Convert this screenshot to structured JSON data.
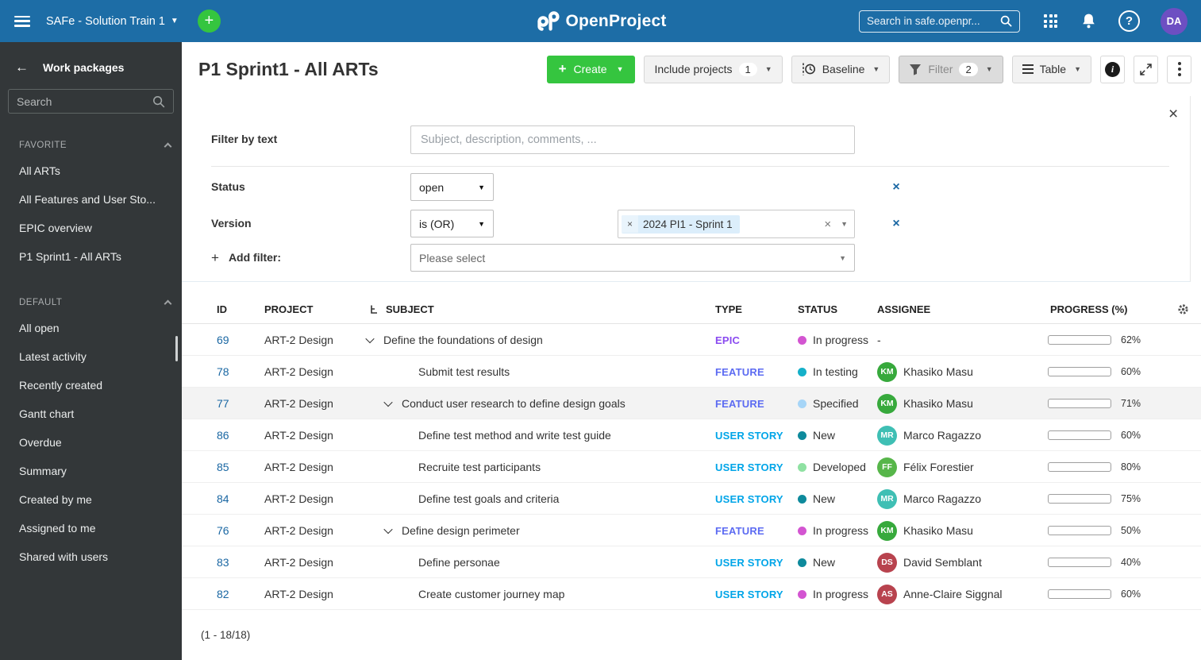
{
  "theme": {
    "header_blue": "#1d6da6",
    "sidebar_bg": "#333739",
    "create_green": "#35c53f",
    "link_blue": "#1a67a3",
    "avatar_purple": "#6d4fc2",
    "progress_fill": "#aed8b2"
  },
  "header": {
    "project_menu": "SAFe - Solution Train 1",
    "logo_text": "OpenProject",
    "search_placeholder": "Search in safe.openpr...",
    "avatar_initials": "DA"
  },
  "sidebar": {
    "title": "Work packages",
    "search_placeholder": "Search",
    "sections": [
      {
        "label": "FAVORITE",
        "items": [
          "All ARTs",
          "All Features and User Sto...",
          "EPIC overview",
          "P1 Sprint1 - All ARTs"
        ]
      },
      {
        "label": "DEFAULT",
        "items": [
          "All open",
          "Latest activity",
          "Recently created",
          "Gantt chart",
          "Overdue",
          "Summary",
          "Created by me",
          "Assigned to me",
          "Shared with users"
        ]
      }
    ]
  },
  "toolbar": {
    "title": "P1 Sprint1 - All ARTs",
    "create_label": "Create",
    "include_projects_label": "Include projects",
    "include_projects_count": "1",
    "baseline_label": "Baseline",
    "filter_label": "Filter",
    "filter_count": "2",
    "table_label": "Table"
  },
  "filters": {
    "text_label": "Filter by text",
    "text_placeholder": "Subject, description, comments, ...",
    "status_label": "Status",
    "status_operator": "open",
    "version_label": "Version",
    "version_operator": "is (OR)",
    "version_value": "2024 PI1 - Sprint 1",
    "add_filter_label": "Add filter:",
    "add_filter_placeholder": "Please select"
  },
  "table": {
    "columns": {
      "id": "ID",
      "project": "PROJECT",
      "subject": "SUBJECT",
      "type": "TYPE",
      "status": "STATUS",
      "assignee": "ASSIGNEE",
      "progress": "PROGRESS (%)"
    },
    "rows": [
      {
        "id": "69",
        "project": "ART-2 Design",
        "subject": "Define the foundations of design",
        "level": 0,
        "expandable": true,
        "highlighted": false,
        "type": "EPIC",
        "type_color": "#8a4bf0",
        "status": "In progress",
        "status_color": "#d355d1",
        "assignee": null,
        "assignee_placeholder": "-",
        "progress": 62
      },
      {
        "id": "78",
        "project": "ART-2 Design",
        "subject": "Submit test results",
        "level": 1,
        "expandable": false,
        "highlighted": false,
        "type": "FEATURE",
        "type_color": "#5c6bf2",
        "status": "In testing",
        "status_color": "#15b0c9",
        "assignee": {
          "initials": "KM",
          "name": "Khasiko Masu",
          "color": "#37a93c"
        },
        "progress": 60
      },
      {
        "id": "77",
        "project": "ART-2 Design",
        "subject": "Conduct user research to define design goals",
        "level": 1,
        "expandable": true,
        "highlighted": true,
        "type": "FEATURE",
        "type_color": "#5c6bf2",
        "status": "Specified",
        "status_color": "#a6d5f7",
        "assignee": {
          "initials": "KM",
          "name": "Khasiko Masu",
          "color": "#37a93c"
        },
        "progress": 71
      },
      {
        "id": "86",
        "project": "ART-2 Design",
        "subject": "Define test method and write test guide",
        "level": 2,
        "expandable": false,
        "highlighted": false,
        "type": "USER STORY",
        "type_color": "#00a5e8",
        "status": "New",
        "status_color": "#0e8a9c",
        "assignee": {
          "initials": "MR",
          "name": "Marco Ragazzo",
          "color": "#3fbfb4"
        },
        "progress": 60
      },
      {
        "id": "85",
        "project": "ART-2 Design",
        "subject": "Recruite test participants",
        "level": 2,
        "expandable": false,
        "highlighted": false,
        "type": "USER STORY",
        "type_color": "#00a5e8",
        "status": "Developed",
        "status_color": "#8fe1a2",
        "assignee": {
          "initials": "FF",
          "name": "Félix Forestier",
          "color": "#57b64a"
        },
        "progress": 80
      },
      {
        "id": "84",
        "project": "ART-2 Design",
        "subject": "Define test goals and criteria",
        "level": 2,
        "expandable": false,
        "highlighted": false,
        "type": "USER STORY",
        "type_color": "#00a5e8",
        "status": "New",
        "status_color": "#0e8a9c",
        "assignee": {
          "initials": "MR",
          "name": "Marco Ragazzo",
          "color": "#3fbfb4"
        },
        "progress": 75
      },
      {
        "id": "76",
        "project": "ART-2 Design",
        "subject": "Define design perimeter",
        "level": 1,
        "expandable": true,
        "highlighted": false,
        "type": "FEATURE",
        "type_color": "#5c6bf2",
        "status": "In progress",
        "status_color": "#d355d1",
        "assignee": {
          "initials": "KM",
          "name": "Khasiko Masu",
          "color": "#37a93c"
        },
        "progress": 50
      },
      {
        "id": "83",
        "project": "ART-2 Design",
        "subject": "Define personae",
        "level": 2,
        "expandable": false,
        "highlighted": false,
        "type": "USER STORY",
        "type_color": "#00a5e8",
        "status": "New",
        "status_color": "#0e8a9c",
        "assignee": {
          "initials": "DS",
          "name": "David Semblant",
          "color": "#b8434e"
        },
        "progress": 40
      },
      {
        "id": "82",
        "project": "ART-2 Design",
        "subject": "Create customer journey map",
        "level": 2,
        "expandable": false,
        "highlighted": false,
        "type": "USER STORY",
        "type_color": "#00a5e8",
        "status": "In progress",
        "status_color": "#d355d1",
        "assignee": {
          "initials": "AS",
          "name": "Anne-Claire Siggnal",
          "color": "#b8434e"
        },
        "progress": 60
      }
    ],
    "footer": "(1 - 18/18)"
  }
}
